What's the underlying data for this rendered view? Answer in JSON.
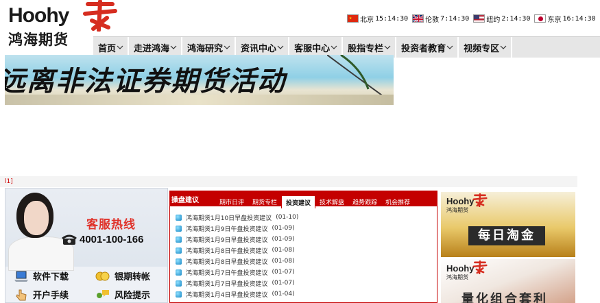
{
  "brand": {
    "name_en": "Hoohy",
    "name_cn": "鸿海期货",
    "accent": "#d62d20"
  },
  "clocks": [
    {
      "city": "北京",
      "time": "15:14:30",
      "flag": "china-flag-icon"
    },
    {
      "city": "伦敦",
      "time": "7:14:30",
      "flag": "uk-flag-icon"
    },
    {
      "city": "纽约",
      "time": "2:14:30",
      "flag": "us-flag-icon"
    },
    {
      "city": "东京",
      "time": "16:14:30",
      "flag": "japan-flag-icon"
    }
  ],
  "nav": [
    {
      "label": "首页"
    },
    {
      "label": "走进鸿海"
    },
    {
      "label": "鸿海研究"
    },
    {
      "label": "资讯中心"
    },
    {
      "label": "客服中心"
    },
    {
      "label": "股指专栏"
    },
    {
      "label": "投资者教育"
    },
    {
      "label": "视频专区"
    }
  ],
  "banner": {
    "text": "远离非法证券期货活动"
  },
  "crumb": "l1]",
  "service": {
    "title": "客服热线",
    "phone": "4001-100-166",
    "links": [
      {
        "label": "软件下载",
        "icon": "laptop-icon"
      },
      {
        "label": "银期转帐",
        "icon": "coins-icon"
      },
      {
        "label": "开户手续",
        "icon": "hand-pointer-icon"
      },
      {
        "label": "风险提示",
        "icon": "chat-person-icon"
      }
    ]
  },
  "ops": {
    "title": "操盘建议",
    "tabs": [
      {
        "label": "期市日评",
        "active": false
      },
      {
        "label": "期货专栏",
        "active": false
      },
      {
        "label": "投资建议",
        "active": true
      },
      {
        "label": "技术解盘",
        "active": false
      },
      {
        "label": "趋势跟踪",
        "active": false
      },
      {
        "label": "机会推荐",
        "active": false
      }
    ],
    "items": [
      {
        "title": "鸿海期货1月10日早盘投资建议",
        "date": "(01-10)"
      },
      {
        "title": "鸿海期货1月9日午盘投资建议",
        "date": "(01-09)"
      },
      {
        "title": "鸿海期货1月9日早盘投资建议",
        "date": "(01-09)"
      },
      {
        "title": "鸿海期货1月8日午盘投资建议",
        "date": "(01-08)"
      },
      {
        "title": "鸿海期货1月8日早盘投资建议",
        "date": "(01-08)"
      },
      {
        "title": "鸿海期货1月7日午盘投资建议",
        "date": "(01-07)"
      },
      {
        "title": "鸿海期货1月7日早盘投资建议",
        "date": "(01-07)"
      },
      {
        "title": "鸿海期货1月4日早盘投资建议",
        "date": "(01-04)"
      }
    ]
  },
  "ads": [
    {
      "brand_en": "Hoohy",
      "brand_cn": "鸿海期货",
      "title": "每日淘金"
    },
    {
      "brand_en": "Hoohy",
      "brand_cn": "鸿海期货",
      "title": "量化组合套利"
    }
  ]
}
